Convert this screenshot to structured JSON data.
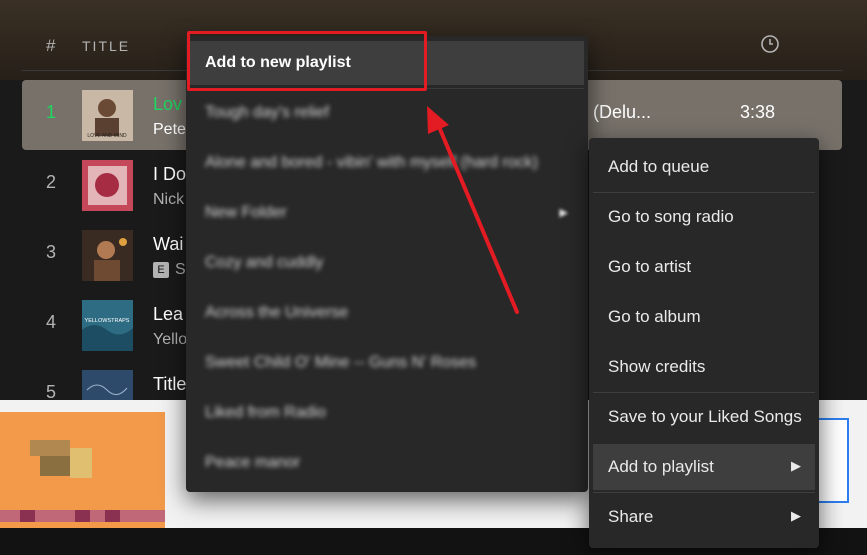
{
  "header": {
    "hash": "#",
    "title_col": "TITLE",
    "clock_icon": "clock-icon"
  },
  "tracks": [
    {
      "num": "1",
      "title": "Lov",
      "artist": "Pete",
      "album_tail": "(Delu...",
      "duration": "3:38",
      "art_text": "LOVE AND MIND"
    },
    {
      "num": "2",
      "title": "I Do",
      "artist": "Nick"
    },
    {
      "num": "3",
      "title": "Wai",
      "artist": "S",
      "explicit": "E"
    },
    {
      "num": "4",
      "title": "Lea",
      "artist": "Yello",
      "art_text": "YELLOWSTRAPS"
    },
    {
      "num": "5",
      "title": "Title"
    }
  ],
  "playlist_menu": {
    "items": [
      {
        "label": "Add to new playlist"
      },
      {
        "label": "Tough day's relief"
      },
      {
        "label": "Alone and bored - vibin' with myself (hard rock)"
      },
      {
        "label": "New Folder"
      },
      {
        "label": "Cozy and cuddly"
      },
      {
        "label": "Across the Universe"
      },
      {
        "label": "Sweet Child O' Mine -- Guns N' Roses"
      },
      {
        "label": "Liked from Radio"
      },
      {
        "label": "Peace manor"
      }
    ]
  },
  "context_menu": {
    "items": [
      {
        "label": "Add to queue"
      },
      {
        "label": "Go to song radio"
      },
      {
        "label": "Go to artist"
      },
      {
        "label": "Go to album"
      },
      {
        "label": "Show credits"
      },
      {
        "label": "Save to your Liked Songs"
      },
      {
        "label": "Add to playlist"
      },
      {
        "label": "Share"
      }
    ]
  },
  "colors": {
    "accent": "#1ed760",
    "highlight_box": "#e31b23",
    "menu_bg": "#282828"
  }
}
